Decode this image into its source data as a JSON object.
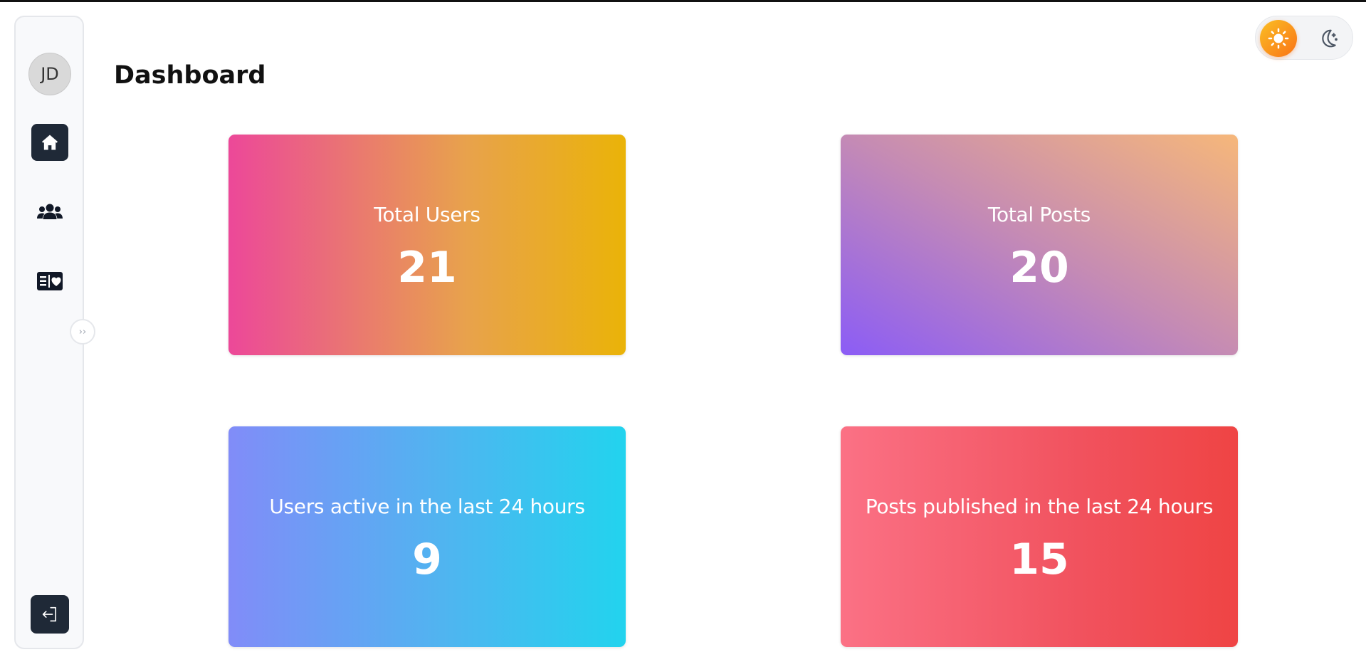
{
  "sidebar": {
    "avatar_initials": "JD",
    "items": [
      {
        "name": "home",
        "icon": "home-icon",
        "active": true
      },
      {
        "name": "users",
        "icon": "users-icon",
        "active": false
      },
      {
        "name": "posts",
        "icon": "post-heart-icon",
        "active": false
      }
    ],
    "logout_icon": "logout-icon",
    "collapse_label": "››"
  },
  "header": {
    "title": "Dashboard"
  },
  "theme_toggle": {
    "selected": "light",
    "options": [
      "light",
      "dark"
    ]
  },
  "colors": {
    "sidebar_active_bg": "#1f2937",
    "theme_light_accent": "#f97316",
    "card_1_gradient": [
      "#ec4899",
      "#eab308"
    ],
    "card_2_gradient": [
      "#8b5cf6",
      "#f6b77a"
    ],
    "card_3_gradient": [
      "#818cf8",
      "#22d3ee"
    ],
    "card_4_gradient": [
      "#fb7185",
      "#ef4444"
    ]
  },
  "stats": [
    {
      "label": "Total Users",
      "value": "21"
    },
    {
      "label": "Total Posts",
      "value": "20"
    },
    {
      "label": "Users active in the last 24 hours",
      "value": "9"
    },
    {
      "label": "Posts published in the last 24 hours",
      "value": "15"
    }
  ]
}
